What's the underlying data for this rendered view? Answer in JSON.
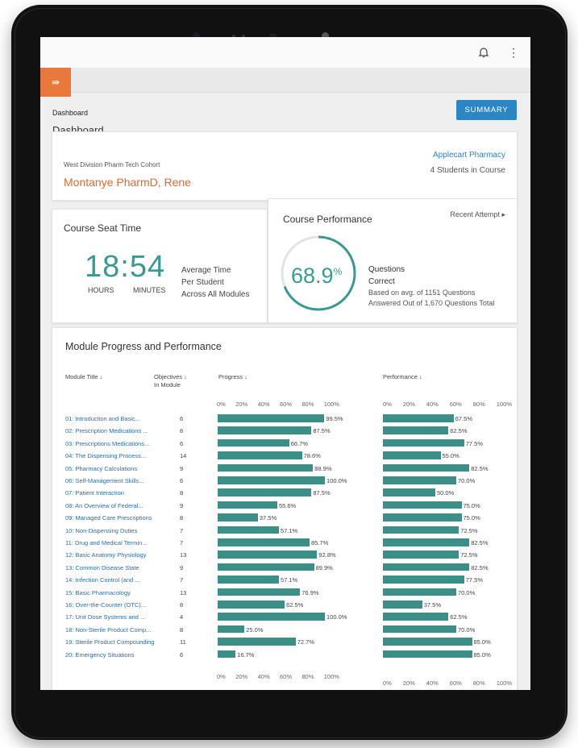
{
  "header": {
    "menu_icon": "collapse-menu-icon",
    "bell_icon": "bell-icon",
    "kebab_icon": "kebab-icon"
  },
  "breadcrumb": "Dashboard",
  "page_title": "Dashboard",
  "summary_label": "SUMMARY",
  "cohort": {
    "name": "West Division Pharm Tech Cohort",
    "person": "Montanye PharmD, Rene",
    "pharmacy": "Applecart Pharmacy",
    "students": "4 Students in Course"
  },
  "seat_time": {
    "title": "Course Seat Time",
    "time": "18:54",
    "hours_label": "HOURS",
    "minutes_label": "MINUTES",
    "avg_lines": [
      "Average Time",
      "Per Student",
      "Across All Modules"
    ]
  },
  "performance": {
    "title": "Course Performance",
    "recent_label": "Recent Attempt",
    "percent": "68.9",
    "percent_sign": "%",
    "ring_value": 0.689,
    "questions_lines": [
      "Questions",
      "Correct"
    ],
    "basis_lines": [
      "Based on avg. of 1151 Questions",
      "Answered Out of 1,670 Questions Total"
    ]
  },
  "module": {
    "title": "Module Progress and Performance",
    "col_title": "Module Title",
    "col_objectives": [
      "Objectives",
      "In Module"
    ],
    "col_progress": "Progress",
    "col_performance": "Performance",
    "ticks": [
      "0%",
      "20%",
      "40%",
      "60%",
      "80%",
      "100%"
    ],
    "rows": [
      {
        "title": "01: Introduction and Basic...",
        "objectives": "6",
        "progress": 99.5,
        "progress_label": "99.5%",
        "performance": 67.5,
        "performance_label": "67.5%"
      },
      {
        "title": "02: Prescription Medications ...",
        "objectives": "8",
        "progress": 87.5,
        "progress_label": "87.5%",
        "performance": 62.5,
        "performance_label": "62.5%"
      },
      {
        "title": "03: Prescriptions Medications...",
        "objectives": "6",
        "progress": 66.7,
        "progress_label": "66.7%",
        "performance": 77.5,
        "performance_label": "77.5%"
      },
      {
        "title": "04: The Dispensing Process...",
        "objectives": "14",
        "progress": 78.6,
        "progress_label": "78.6%",
        "performance": 55.0,
        "performance_label": "55.0%"
      },
      {
        "title": "05: Pharmacy Calculations",
        "objectives": "9",
        "progress": 88.9,
        "progress_label": "88.9%",
        "performance": 82.5,
        "performance_label": "82.5%"
      },
      {
        "title": "06: Self-Management Skills...",
        "objectives": "6",
        "progress": 100.0,
        "progress_label": "100.0%",
        "performance": 70.0,
        "performance_label": "70.0%"
      },
      {
        "title": "07: Patient Interaction",
        "objectives": "8",
        "progress": 87.5,
        "progress_label": "87.5%",
        "performance": 50.0,
        "performance_label": "50.0%"
      },
      {
        "title": "08: An Overview of Federal...",
        "objectives": "9",
        "progress": 55.6,
        "progress_label": "55.6%",
        "performance": 75.0,
        "performance_label": "75.0%"
      },
      {
        "title": "09: Managed Care Prescriptions",
        "objectives": "8",
        "progress": 37.5,
        "progress_label": "37.5%",
        "performance": 75.0,
        "performance_label": "75.0%"
      },
      {
        "title": "10: Non-Dispensing Duties",
        "objectives": "7",
        "progress": 57.1,
        "progress_label": "57.1%",
        "performance": 72.5,
        "performance_label": "72.5%"
      },
      {
        "title": "11: Drug and Medical Termin...",
        "objectives": "7",
        "progress": 85.7,
        "progress_label": "85.7%",
        "performance": 82.5,
        "performance_label": "82.5%"
      },
      {
        "title": "12: Basic Anatomy Physiology",
        "objectives": "13",
        "progress": 92.8,
        "progress_label": "92.8%",
        "performance": 72.5,
        "performance_label": "72.5%"
      },
      {
        "title": "13: Common Disease State",
        "objectives": "9",
        "progress": 89.9,
        "progress_label": "89.9%",
        "performance": 82.5,
        "performance_label": "82.5%"
      },
      {
        "title": "14: Infection Control (and ...",
        "objectives": "7",
        "progress": 57.1,
        "progress_label": "57.1%",
        "performance": 77.5,
        "performance_label": "77.5%"
      },
      {
        "title": "15: Basic Pharmacology",
        "objectives": "13",
        "progress": 76.9,
        "progress_label": "76.9%",
        "performance": 70.0,
        "performance_label": "70.0%"
      },
      {
        "title": "16: Over-the-Counter (OTC)...",
        "objectives": "8",
        "progress": 62.5,
        "progress_label": "62.5%",
        "performance": 37.5,
        "performance_label": "37.5%"
      },
      {
        "title": "17: Unit Dose Systems and ...",
        "objectives": "4",
        "progress": 100.0,
        "progress_label": "100.0%",
        "performance": 62.5,
        "performance_label": "62.5%"
      },
      {
        "title": "18: Non-Sterile Product Comp...",
        "objectives": "8",
        "progress": 25.0,
        "progress_label": "25.0%",
        "performance": 70.0,
        "performance_label": "70.0%"
      },
      {
        "title": "19: Sterile Product Compounding",
        "objectives": "11",
        "progress": 72.7,
        "progress_label": "72.7%",
        "performance": 85.0,
        "performance_label": "85.0%"
      },
      {
        "title": "20: Emergency Situations",
        "objectives": "6",
        "progress": 16.7,
        "progress_label": "16.7%",
        "performance": 85.0,
        "performance_label": "85.0%"
      }
    ]
  },
  "colors": {
    "accent_orange": "#e8783c",
    "teal": "#3c8f86",
    "blue": "#2b86c5"
  }
}
